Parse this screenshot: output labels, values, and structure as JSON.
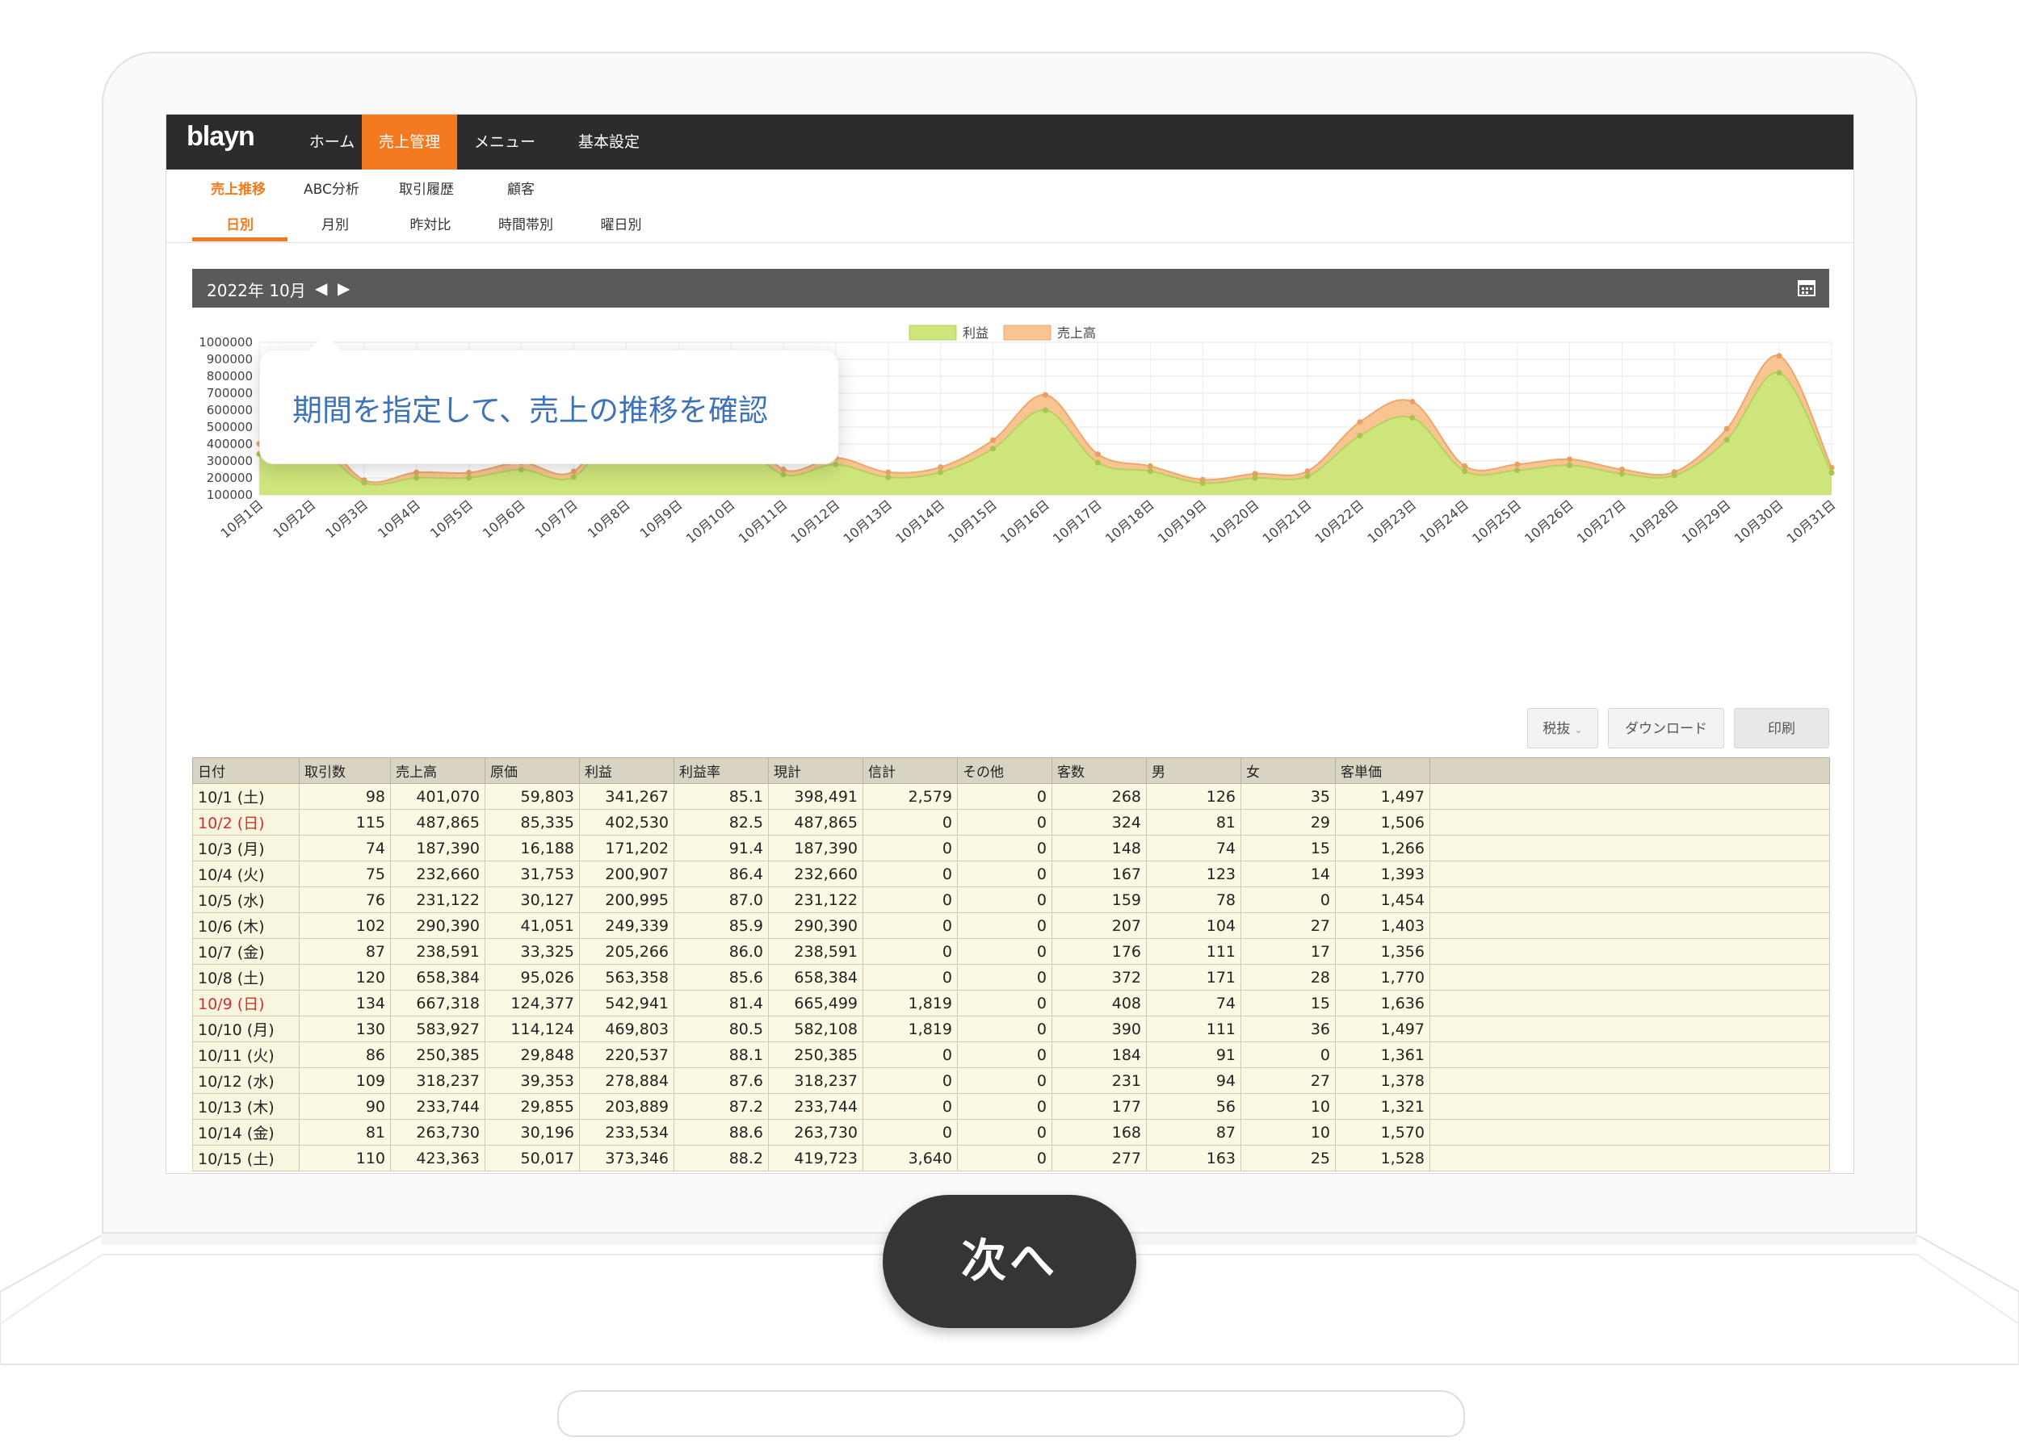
{
  "app": {
    "logo": "blayn",
    "nav": [
      "ホーム",
      "売上管理",
      "メニュー",
      "基本設定"
    ],
    "nav_active": "売上管理"
  },
  "subnav": {
    "primary": [
      "売上推移",
      "ABC分析",
      "取引履歴",
      "顧客"
    ],
    "secondary": [
      "日別",
      "月別",
      "昨対比",
      "時間帯別",
      "曜日別"
    ]
  },
  "period": {
    "label": "2022年 10月",
    "prev_icon": "triangle-left-icon",
    "next_icon": "triangle-right-icon",
    "calendar_icon": "calendar-icon"
  },
  "tooltip": "期間を指定して、売上の推移を確認",
  "controls": {
    "tax": "税抜",
    "download": "ダウンロード",
    "print": "印刷"
  },
  "next_button": "次へ",
  "colors": {
    "accent": "#f47a20",
    "profit": "#c8e36e",
    "sales": "#f8c592"
  },
  "chart_data": {
    "type": "area",
    "legend": [
      "利益",
      "売上高"
    ],
    "categories": [
      "10月1日",
      "10月2日",
      "10月3日",
      "10月4日",
      "10月5日",
      "10月6日",
      "10月7日",
      "10月8日",
      "10月9日",
      "10月10日",
      "10月11日",
      "10月12日",
      "10月13日",
      "10月14日",
      "10月15日",
      "10月16日",
      "10月17日",
      "10月18日",
      "10月19日",
      "10月20日",
      "10月21日",
      "10月22日",
      "10月23日",
      "10月24日",
      "10月25日",
      "10月26日",
      "10月27日",
      "10月28日",
      "10月29日",
      "10月30日",
      "10月31日"
    ],
    "series": [
      {
        "name": "売上高",
        "values": [
          401070,
          487865,
          187390,
          232660,
          231122,
          290390,
          238591,
          658384,
          667318,
          583927,
          250385,
          318237,
          233744,
          263730,
          423363,
          690000,
          340000,
          270000,
          190000,
          225000,
          240000,
          530000,
          650000,
          270000,
          280000,
          310000,
          250000,
          235000,
          490000,
          920000,
          260000
        ]
      },
      {
        "name": "利益",
        "values": [
          341267,
          402530,
          171202,
          200907,
          200995,
          249339,
          205266,
          563358,
          542941,
          469803,
          220537,
          278884,
          203889,
          233534,
          373346,
          600000,
          290000,
          240000,
          170000,
          200000,
          210000,
          450000,
          555000,
          240000,
          245000,
          275000,
          225000,
          215000,
          425000,
          820000,
          230000
        ]
      }
    ],
    "yticks": [
      "1000000",
      "900000",
      "800000",
      "700000",
      "600000",
      "500000",
      "400000",
      "300000",
      "200000",
      "100000"
    ],
    "ylim": [
      100000,
      1000000
    ]
  },
  "table": {
    "headers": [
      "日付",
      "取引数",
      "売上高",
      "原価",
      "利益",
      "利益率",
      "現計",
      "信計",
      "その他",
      "客数",
      "男",
      "女",
      "客単価"
    ],
    "rows": [
      [
        "10/1 (土)",
        "98",
        "401,070",
        "59,803",
        "341,267",
        "85.1",
        "398,491",
        "2,579",
        "0",
        "268",
        "126",
        "35",
        "1,497"
      ],
      [
        "10/2 (日)",
        "115",
        "487,865",
        "85,335",
        "402,530",
        "82.5",
        "487,865",
        "0",
        "0",
        "324",
        "81",
        "29",
        "1,506"
      ],
      [
        "10/3 (月)",
        "74",
        "187,390",
        "16,188",
        "171,202",
        "91.4",
        "187,390",
        "0",
        "0",
        "148",
        "74",
        "15",
        "1,266"
      ],
      [
        "10/4 (火)",
        "75",
        "232,660",
        "31,753",
        "200,907",
        "86.4",
        "232,660",
        "0",
        "0",
        "167",
        "123",
        "14",
        "1,393"
      ],
      [
        "10/5 (水)",
        "76",
        "231,122",
        "30,127",
        "200,995",
        "87.0",
        "231,122",
        "0",
        "0",
        "159",
        "78",
        "0",
        "1,454"
      ],
      [
        "10/6 (木)",
        "102",
        "290,390",
        "41,051",
        "249,339",
        "85.9",
        "290,390",
        "0",
        "0",
        "207",
        "104",
        "27",
        "1,403"
      ],
      [
        "10/7 (金)",
        "87",
        "238,591",
        "33,325",
        "205,266",
        "86.0",
        "238,591",
        "0",
        "0",
        "176",
        "111",
        "17",
        "1,356"
      ],
      [
        "10/8 (土)",
        "120",
        "658,384",
        "95,026",
        "563,358",
        "85.6",
        "658,384",
        "0",
        "0",
        "372",
        "171",
        "28",
        "1,770"
      ],
      [
        "10/9 (日)",
        "134",
        "667,318",
        "124,377",
        "542,941",
        "81.4",
        "665,499",
        "1,819",
        "0",
        "408",
        "74",
        "15",
        "1,636"
      ],
      [
        "10/10 (月)",
        "130",
        "583,927",
        "114,124",
        "469,803",
        "80.5",
        "582,108",
        "1,819",
        "0",
        "390",
        "111",
        "36",
        "1,497"
      ],
      [
        "10/11 (火)",
        "86",
        "250,385",
        "29,848",
        "220,537",
        "88.1",
        "250,385",
        "0",
        "0",
        "184",
        "91",
        "0",
        "1,361"
      ],
      [
        "10/12 (水)",
        "109",
        "318,237",
        "39,353",
        "278,884",
        "87.6",
        "318,237",
        "0",
        "0",
        "231",
        "94",
        "27",
        "1,378"
      ],
      [
        "10/13 (木)",
        "90",
        "233,744",
        "29,855",
        "203,889",
        "87.2",
        "233,744",
        "0",
        "0",
        "177",
        "56",
        "10",
        "1,321"
      ],
      [
        "10/14 (金)",
        "81",
        "263,730",
        "30,196",
        "233,534",
        "88.6",
        "263,730",
        "0",
        "0",
        "168",
        "87",
        "10",
        "1,570"
      ],
      [
        "10/15 (土)",
        "110",
        "423,363",
        "50,017",
        "373,346",
        "88.2",
        "419,723",
        "3,640",
        "0",
        "277",
        "163",
        "25",
        "1,528"
      ]
    ],
    "sunday_rows": [
      1,
      8
    ]
  }
}
